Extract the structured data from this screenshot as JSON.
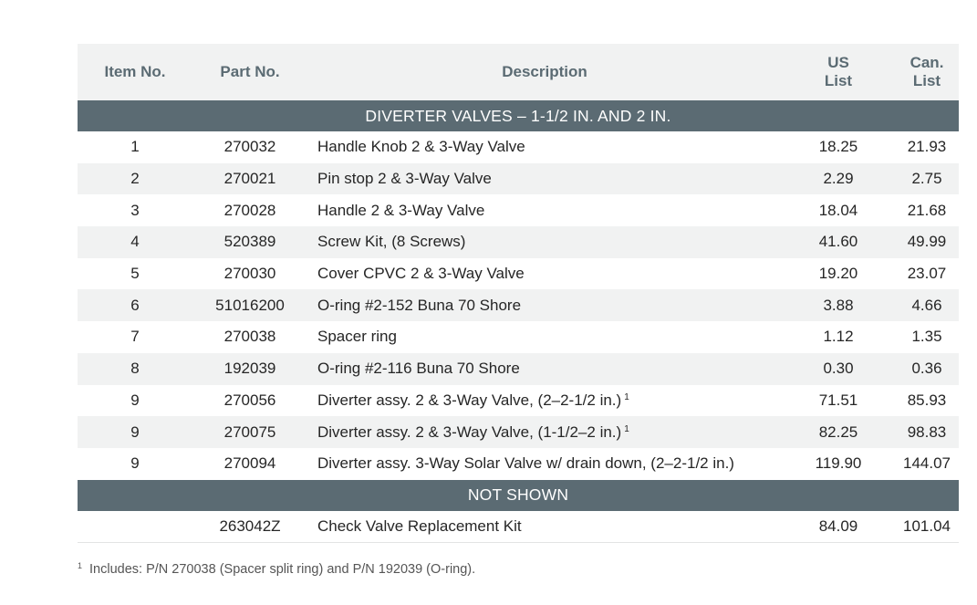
{
  "headers": {
    "item": "Item No.",
    "part": "Part No.",
    "desc": "Description",
    "us_line1": "US",
    "us_line2": "List",
    "can_line1": "Can.",
    "can_line2": "List"
  },
  "sections": [
    {
      "title": "DIVERTER VALVES – 1-1/2 IN. AND 2 IN.",
      "rows": [
        {
          "item": "1",
          "part": "270032",
          "desc": "Handle Knob 2 & 3-Way Valve",
          "fn": "",
          "us": "18.25",
          "can": "21.93"
        },
        {
          "item": "2",
          "part": "270021",
          "desc": "Pin stop 2 & 3-Way Valve",
          "fn": "",
          "us": "2.29",
          "can": "2.75"
        },
        {
          "item": "3",
          "part": "270028",
          "desc": "Handle 2 & 3-Way Valve",
          "fn": "",
          "us": "18.04",
          "can": "21.68"
        },
        {
          "item": "4",
          "part": "520389",
          "desc": "Screw Kit, (8 Screws)",
          "fn": "",
          "us": "41.60",
          "can": "49.99"
        },
        {
          "item": "5",
          "part": "270030",
          "desc": "Cover CPVC 2 & 3-Way Valve",
          "fn": "",
          "us": "19.20",
          "can": "23.07"
        },
        {
          "item": "6",
          "part": "51016200",
          "desc": "O-ring #2-152 Buna 70 Shore",
          "fn": "",
          "us": "3.88",
          "can": "4.66"
        },
        {
          "item": "7",
          "part": "270038",
          "desc": "Spacer ring",
          "fn": "",
          "us": "1.12",
          "can": "1.35"
        },
        {
          "item": "8",
          "part": "192039",
          "desc": "O-ring #2-116 Buna 70 Shore",
          "fn": "",
          "us": "0.30",
          "can": "0.36"
        },
        {
          "item": "9",
          "part": "270056",
          "desc": "Diverter assy. 2 & 3-Way Valve, (2–2-1/2 in.)",
          "fn": "1",
          "us": "71.51",
          "can": "85.93"
        },
        {
          "item": "9",
          "part": "270075",
          "desc": "Diverter assy. 2 & 3-Way Valve, (1-1/2–2 in.)",
          "fn": "1",
          "us": "82.25",
          "can": "98.83"
        },
        {
          "item": "9",
          "part": "270094",
          "desc": "Diverter assy. 3-Way Solar Valve w/ drain down, (2–2-1/2 in.)",
          "fn": "",
          "us": "119.90",
          "can": "144.07"
        }
      ]
    },
    {
      "title": "NOT SHOWN",
      "rows": [
        {
          "item": "",
          "part": "263042Z",
          "desc": "Check Valve Replacement Kit",
          "fn": "",
          "us": "84.09",
          "can": "101.04"
        }
      ]
    }
  ],
  "footnote": {
    "marker": "1",
    "text": "Includes: P/N 270038 (Spacer split ring) and P/N 192039 (O-ring)."
  }
}
